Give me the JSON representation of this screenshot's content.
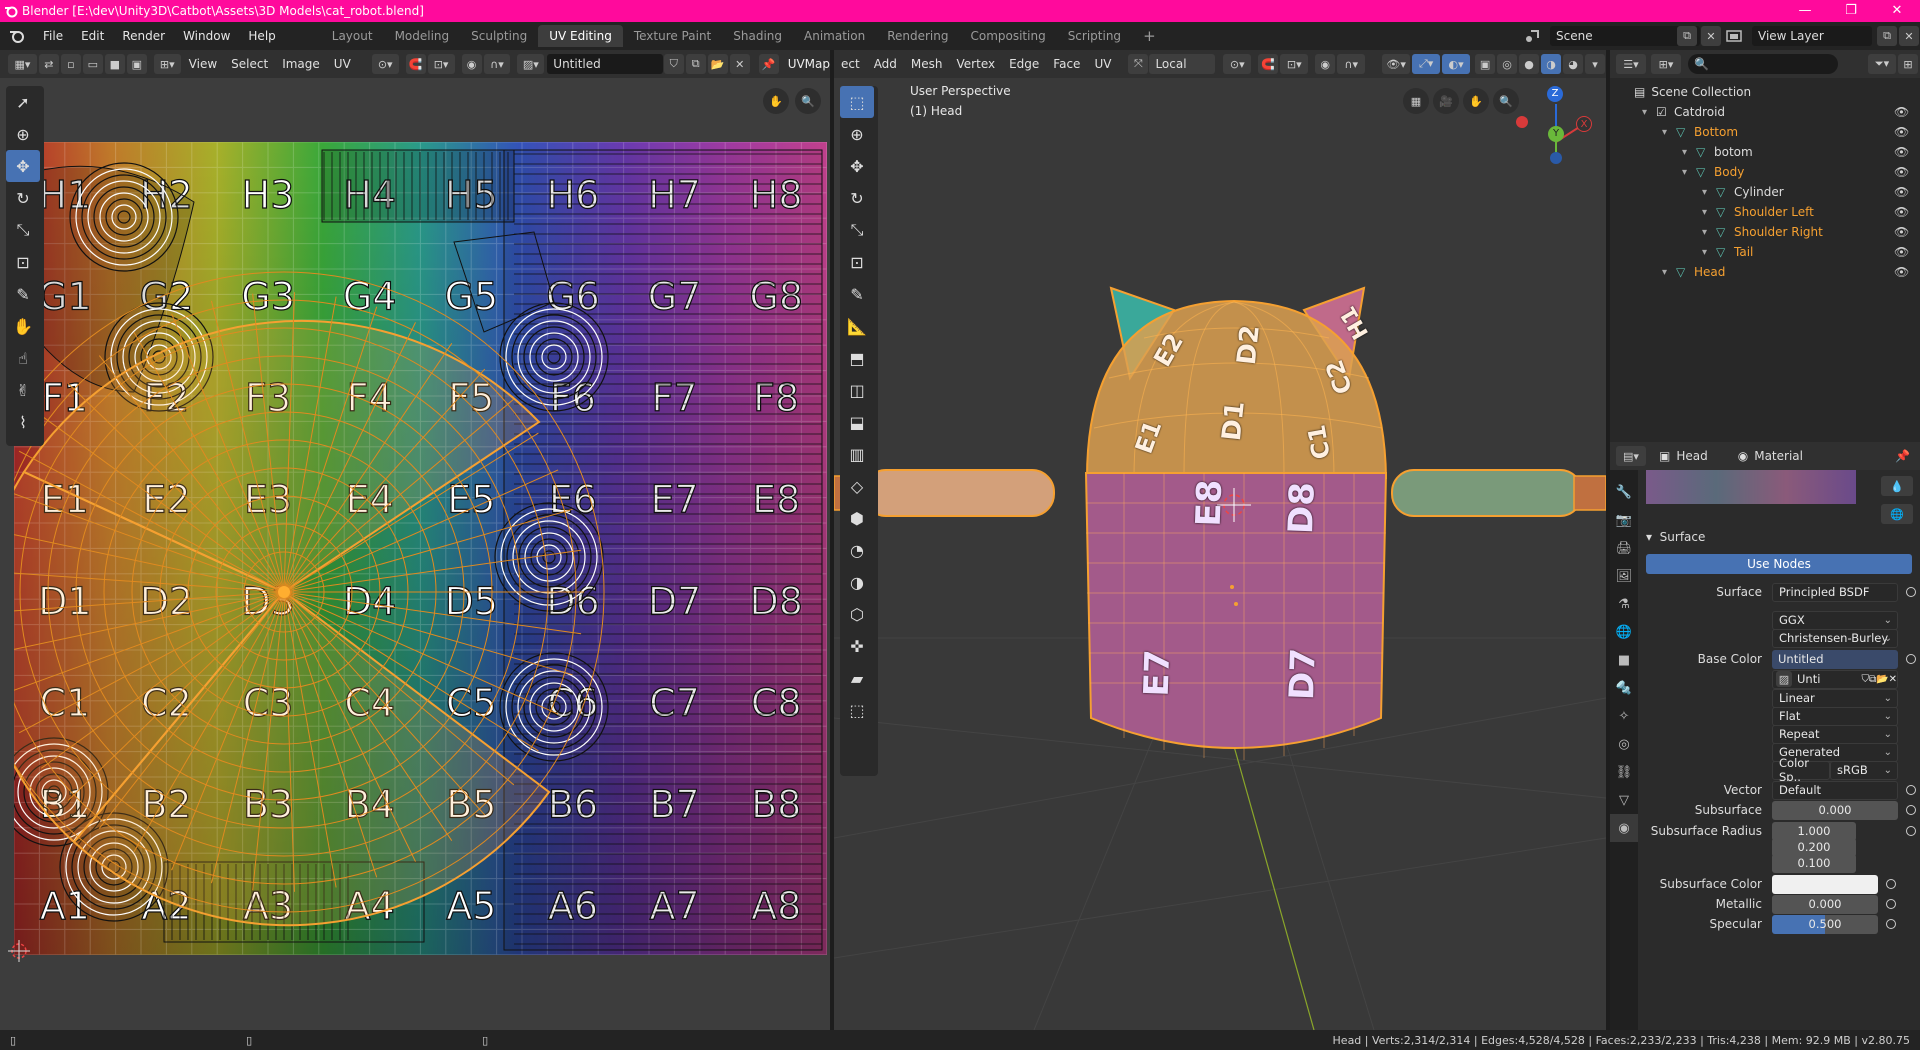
{
  "titlebar": {
    "title": "Blender [E:\\dev\\Unity3D\\Catbot\\Assets\\3D Models\\cat_robot.blend]",
    "minimize": "—",
    "maximize": "❐",
    "close": "✕"
  },
  "menu": [
    "File",
    "Edit",
    "Render",
    "Window",
    "Help"
  ],
  "workspaces": [
    "Layout",
    "Modeling",
    "Sculpting",
    "UV Editing",
    "Texture Paint",
    "Shading",
    "Animation",
    "Rendering",
    "Compositing",
    "Scripting"
  ],
  "workspace_add": "+",
  "scene": {
    "name": "Scene",
    "view_layer": "View Layer"
  },
  "uv_editor": {
    "menus": [
      "View",
      "Select",
      "Image",
      "UV"
    ],
    "image_name": "Untitled",
    "uv_map_label": "UVMap"
  },
  "uv_labels": [
    [
      "H1",
      "H2",
      "H3",
      "H4",
      "H5",
      "H6",
      "H7",
      "H8"
    ],
    [
      "G1",
      "G2",
      "G3",
      "G4",
      "G5",
      "G6",
      "G7",
      "G8"
    ],
    [
      "F1",
      "F2",
      "F3",
      "F4",
      "F5",
      "F6",
      "F7",
      "F8"
    ],
    [
      "E1",
      "E2",
      "E3",
      "E4",
      "E5",
      "E6",
      "E7",
      "E8"
    ],
    [
      "D1",
      "D2",
      "D3",
      "D4",
      "D5",
      "D6",
      "D7",
      "D8"
    ],
    [
      "C1",
      "C2",
      "C3",
      "C4",
      "C5",
      "C6",
      "C7",
      "C8"
    ],
    [
      "B1",
      "B2",
      "B3",
      "B4",
      "B5",
      "B6",
      "B7",
      "B8"
    ],
    [
      "A1",
      "A2",
      "A3",
      "A4",
      "A5",
      "A6",
      "A7",
      "A8"
    ]
  ],
  "viewport": {
    "menus": [
      "ect",
      "Add",
      "Mesh",
      "Vertex",
      "Edge",
      "Face",
      "UV"
    ],
    "transform_orientation": "Local",
    "perspective_label": "User Perspective",
    "object_label": "(1) Head",
    "mesh_labels": {
      "e8": "E8",
      "d8": "D8",
      "e7": "E7",
      "d7": "D7",
      "d1": "D1",
      "d2": "D2",
      "e1": "E1",
      "e2": "E2",
      "c1": "C1",
      "h1": "H1",
      "c2": "C2"
    },
    "gizmo": {
      "z": "Z",
      "y": "Y",
      "x": "X"
    }
  },
  "outliner": {
    "root": "Scene Collection",
    "items": [
      {
        "label": "Catdroid",
        "level": 1,
        "orange": false
      },
      {
        "label": "Bottom",
        "level": 2,
        "orange": true
      },
      {
        "label": "botom",
        "level": 3,
        "orange": false
      },
      {
        "label": "Body",
        "level": 3,
        "orange": true
      },
      {
        "label": "Cylinder",
        "level": 4,
        "orange": false
      },
      {
        "label": "Shoulder Left",
        "level": 4,
        "orange": true
      },
      {
        "label": "Shoulder Right",
        "level": 4,
        "orange": true
      },
      {
        "label": "Tail",
        "level": 4,
        "orange": true
      },
      {
        "label": "Head",
        "level": 2,
        "orange": true
      }
    ]
  },
  "properties": {
    "object": "Head",
    "tab": "Material",
    "panel": "Surface",
    "use_nodes": "Use Nodes",
    "fields": {
      "surface_label": "Surface",
      "surface_value": "Principled BSDF",
      "distribution": "GGX",
      "sss_method": "Christensen-Burley",
      "base_color_label": "Base Color",
      "base_color_value": "Untitled",
      "image_short": "Unti",
      "interpolation": "Linear",
      "projection": "Flat",
      "extension": "Repeat",
      "source": "Generated",
      "color_space_label": "Color Sp..",
      "color_space_value": "sRGB",
      "vector_label": "Vector",
      "vector_value": "Default",
      "subsurface_label": "Subsurface",
      "subsurface_value": "0.000",
      "ss_radius_label": "Subsurface Radius",
      "ss_radius": [
        "1.000",
        "0.200",
        "0.100"
      ],
      "ss_color_label": "Subsurface Color",
      "metallic_label": "Metallic",
      "metallic_value": "0.000",
      "specular_label": "Specular",
      "specular_value": "0.500"
    }
  },
  "status": {
    "text": "Head | Verts:2,314/2,314 | Edges:4,528/4,528 | Faces:2,233/2,233 | Tris:4,238 | Mem: 92.9 MB | v2.80.75"
  },
  "colors": {
    "title_bar": "#ff0a9c",
    "active_tool": "#4772b3",
    "selection_orange": "#f5a031",
    "outliner_orange": "#f5a031"
  }
}
